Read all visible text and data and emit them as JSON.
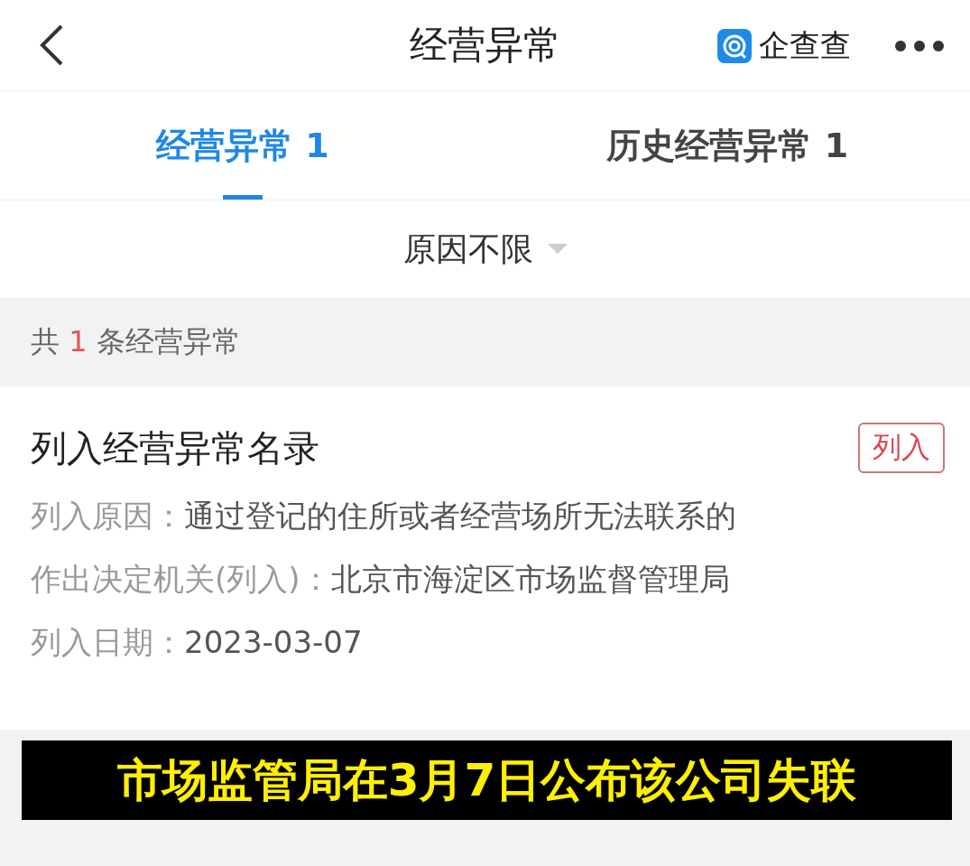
{
  "header": {
    "title": "经营异常",
    "brand": "企查查"
  },
  "tabs": [
    {
      "label": "经营异常 1",
      "selected": true
    },
    {
      "label": "历史经营异常 1",
      "selected": false
    }
  ],
  "filter": {
    "label": "原因不限"
  },
  "summary": {
    "prefix": "共",
    "count": "1",
    "suffix": "条经营异常"
  },
  "record": {
    "title": "列入经营异常名录",
    "tag": "列入",
    "fields": [
      {
        "label": "列入原因：",
        "value": "通过登记的住所或者经营场所无法联系的"
      },
      {
        "label": "作出决定机关(列入)：",
        "value": "北京市海淀区市场监督管理局"
      },
      {
        "label": "列入日期：",
        "value": "2023-03-07"
      }
    ]
  },
  "caption": "市场监管局在3月7日公布该公司失联"
}
